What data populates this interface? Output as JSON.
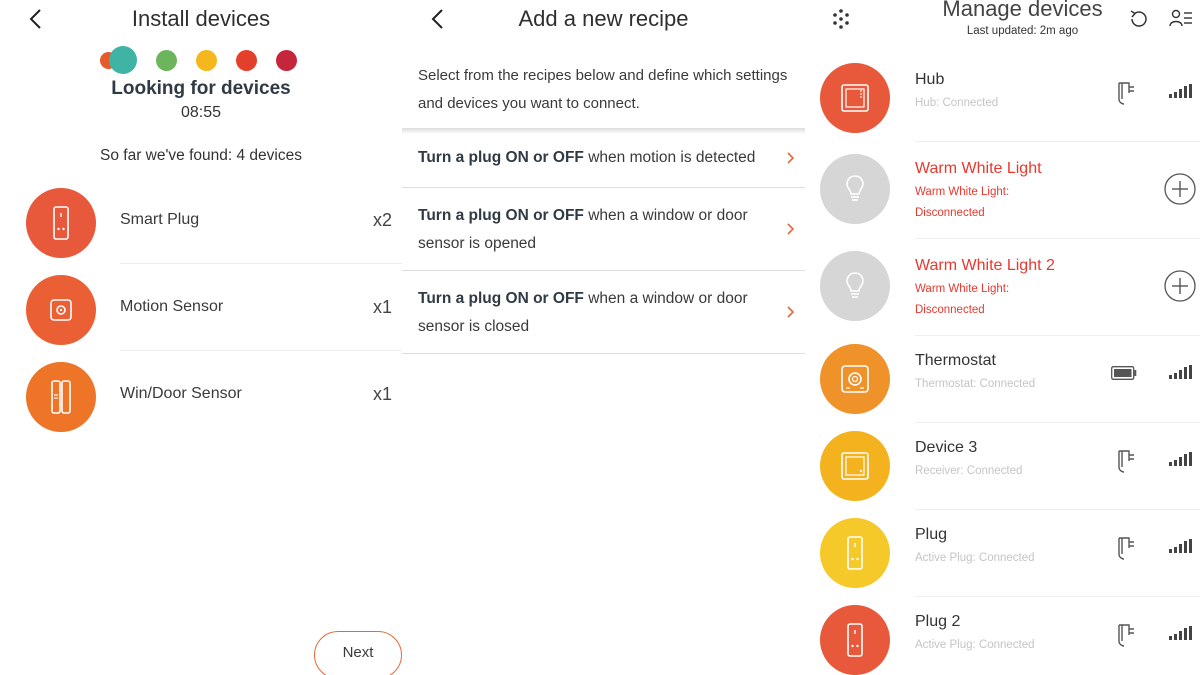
{
  "install": {
    "title": "Install devices",
    "looking": "Looking for devices",
    "timer": "08:55",
    "found": "So far we've found: 4 devices",
    "next": "Next",
    "devices": [
      {
        "name": "Smart Plug",
        "count": "x2",
        "color": "#e8583a",
        "icon": "plug-icon"
      },
      {
        "name": "Motion Sensor",
        "count": "x1",
        "color": "#eb5f34",
        "icon": "motion-sensor-icon"
      },
      {
        "name": "Win/Door Sensor",
        "count": "x1",
        "color": "#ee7427",
        "icon": "door-sensor-icon"
      }
    ],
    "dot_colors": [
      "#e75a2c",
      "#3fb4a4",
      "#6cb55c",
      "#f4b71d",
      "#e2402b",
      "#c4263c"
    ]
  },
  "recipe": {
    "title": "Add a new recipe",
    "intro": "Select from the recipes below and define which settings and devices you want to connect.",
    "items": [
      {
        "bold": "Turn a plug ON or OFF",
        "rest": " when motion is detected"
      },
      {
        "bold": "Turn a plug ON or OFF",
        "rest": " when a window or door sensor is opened"
      },
      {
        "bold": "Turn a plug ON or OFF",
        "rest": " when a window or door sensor is closed"
      }
    ],
    "accent": "#e5683a"
  },
  "manage": {
    "title": "Manage devices",
    "last_updated": "Last updated: 2m ago",
    "devices": [
      {
        "name": "Hub",
        "status": "Hub:  Connected",
        "color": "#e8583a",
        "icon": "hub-icon",
        "power": "plug",
        "signal": true,
        "error": false
      },
      {
        "name": "Warm White Light",
        "status": "Warm White Light:",
        "status2": "Disconnected",
        "color": "#d6d6d6",
        "icon": "bulb-icon",
        "power": "add",
        "error": true
      },
      {
        "name": "Warm White Light 2",
        "status": "Warm White Light:",
        "status2": "Disconnected",
        "color": "#d6d6d6",
        "icon": "bulb-icon",
        "power": "add",
        "error": true
      },
      {
        "name": "Thermostat",
        "status": "Thermostat:  Connected",
        "color": "#f0922a",
        "icon": "thermostat-icon",
        "power": "battery",
        "signal": true,
        "error": false
      },
      {
        "name": "Device 3",
        "status": "Receiver:  Connected",
        "color": "#f4b21f",
        "icon": "receiver-icon",
        "power": "plug",
        "signal": true,
        "error": false
      },
      {
        "name": "Plug",
        "status": "Active Plug:  Connected",
        "color": "#f6c92a",
        "icon": "plug-icon",
        "power": "plug",
        "signal": true,
        "error": false
      },
      {
        "name": "Plug 2",
        "status": "Active Plug:  Connected",
        "color": "#e8583a",
        "icon": "plug-icon",
        "power": "plug",
        "signal": true,
        "error": false
      }
    ]
  }
}
